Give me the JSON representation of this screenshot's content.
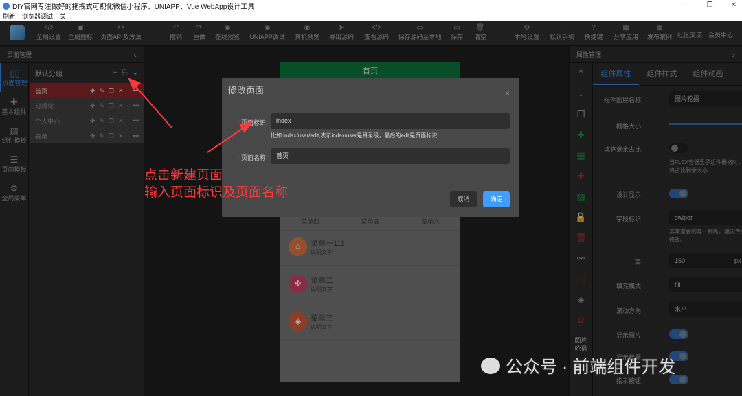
{
  "window": {
    "title": "DIY官网专注做好的拖拽式可视化微信小程序、UNIAPP、Vue WebApp设计工具",
    "controls": [
      "—",
      "❐",
      "✕"
    ]
  },
  "menu": [
    "刷新",
    "浏览器调试",
    "关于"
  ],
  "toolbar": [
    {
      "icon": "</>",
      "label": "全局设置"
    },
    {
      "icon": "▣",
      "label": "全局图标"
    },
    {
      "icon": "⚯",
      "label": "页面API及方法"
    },
    {
      "icon": "↶",
      "label": "撤销"
    },
    {
      "icon": "↷",
      "label": "重做"
    },
    {
      "icon": "◉",
      "label": "在线预览"
    },
    {
      "icon": "◉",
      "label": "UNIAPP调试"
    },
    {
      "icon": "◉",
      "label": "真机预览"
    },
    {
      "icon": "➤",
      "label": "导出源码"
    },
    {
      "icon": "</>",
      "label": "查看源码"
    },
    {
      "icon": "▭",
      "label": "保存源码至本地"
    },
    {
      "icon": "▭",
      "label": "保存"
    },
    {
      "icon": "🗑",
      "label": "清空"
    },
    {
      "icon": "⚙",
      "label": "本地设置"
    },
    {
      "icon": "▯",
      "label": "默认手机"
    },
    {
      "icon": "?",
      "label": "快捷键"
    },
    {
      "icon": "▦",
      "label": "分享应用"
    },
    {
      "icon": "▦",
      "label": "发布案例"
    }
  ],
  "toolbar_links": [
    "社区交流",
    "会员中心"
  ],
  "left": {
    "title": "页面管理",
    "collapse": "‹",
    "nav": [
      {
        "icon": "▯▯",
        "label": "页面管理",
        "active": true
      },
      {
        "icon": "✚",
        "label": "基本组件"
      },
      {
        "icon": "▨",
        "label": "组件模板"
      },
      {
        "icon": "☰",
        "label": "页面模板"
      },
      {
        "icon": "⚙",
        "label": "全局菜单"
      }
    ],
    "group": {
      "label": "默认分组",
      "add": "+",
      "new_page": "⎘",
      "expand": "⌄"
    },
    "pages": [
      {
        "label": "首页",
        "active": true
      },
      {
        "label": "可视化"
      },
      {
        "label": "个人中心"
      },
      {
        "label": "表单"
      }
    ],
    "page_ops": [
      "✥",
      "✎",
      "❐",
      "✕",
      "•••"
    ]
  },
  "phone": {
    "header": "首页",
    "menu_row": [
      "菜单四",
      "菜单五",
      "菜单六"
    ],
    "items": [
      {
        "title": "菜单一111",
        "desc": "说明文字",
        "icon": "⌂",
        "color": "#c86a3c"
      },
      {
        "title": "菜单二",
        "desc": "说明文字",
        "icon": "✤",
        "color": "#b8385a"
      },
      {
        "title": "菜单三",
        "desc": "说明文字",
        "icon": "◈",
        "color": "#c05030"
      }
    ]
  },
  "right": {
    "title": "属性管理",
    "collapse": "›",
    "tabs": [
      "组件属性",
      "组件样式",
      "组件动画"
    ],
    "icons": [
      "⤒",
      "⤓",
      "❐",
      "✚",
      "▤",
      "✚",
      "▨",
      "🔓",
      "🗑",
      "⚯",
      "⬚",
      "◈",
      "⚙"
    ],
    "side_label": "图片轮播",
    "props": {
      "layer_name_label": "组件图层名称",
      "layer_name": "图片轮播",
      "grid_label": "栅格大小",
      "grid_value": 1.0,
      "fill_label": "填充剩余占比",
      "fill_on": false,
      "fill_hint": "当FLEX容器里子组件栅格时，此属性将占比剩余大小",
      "design_label": "设计显示",
      "design_on": true,
      "field_label": "字段标识",
      "field_value": "swiper",
      "field_hint": "非常重要的唯一判断，建议专业人员修改。",
      "height_label": "高",
      "height_value": "150",
      "height_unit": "px",
      "fillmode_label": "填充模式",
      "fillmode_value": "fill",
      "scroll_label": "滚动方向",
      "scroll_value": "水平",
      "showimg_label": "显示图片",
      "showimg_on": true,
      "showtitle_label": "显示标题",
      "showtitle_on": true,
      "indicator_label": "指示按钮",
      "indicator_on": true
    }
  },
  "dialog": {
    "title": "修改页面",
    "close": "×",
    "id_label": "页面标识",
    "id_value": "index",
    "id_hint": "比如:index/user/edit,表示index/user是目录级，最后的edit是页面标识",
    "name_label": "页面名称",
    "name_value": "首页",
    "cancel": "取消",
    "confirm": "确定"
  },
  "annotation": [
    "点击新建页面",
    "输入页面标识及页面名称"
  ],
  "watermark": "公众号 · 前端组件开发",
  "colors": {
    "accent": "#2f7fd3",
    "active_page": "#7a2222",
    "phone_header": "#0b6a35",
    "annotation": "#ff3a3a",
    "confirm": "#409eff"
  }
}
